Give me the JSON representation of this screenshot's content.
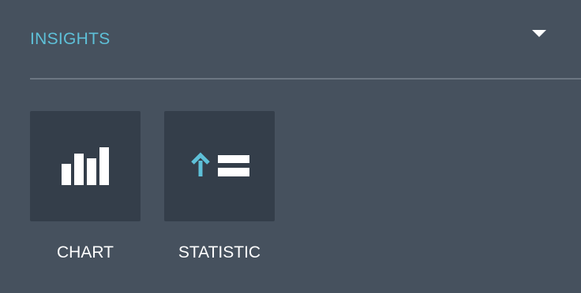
{
  "insights": {
    "title": "INSIGHTS",
    "toggle_icon": "caret-down-icon",
    "items": [
      {
        "label": "CHART",
        "icon": "bar-chart-icon"
      },
      {
        "label": "STATISTIC",
        "icon": "statistic-icon"
      }
    ]
  },
  "colors": {
    "background": "#46515e",
    "tile": "#343e4a",
    "accent": "#5ec0d8",
    "divider": "#6c7682",
    "text": "#ffffff"
  }
}
